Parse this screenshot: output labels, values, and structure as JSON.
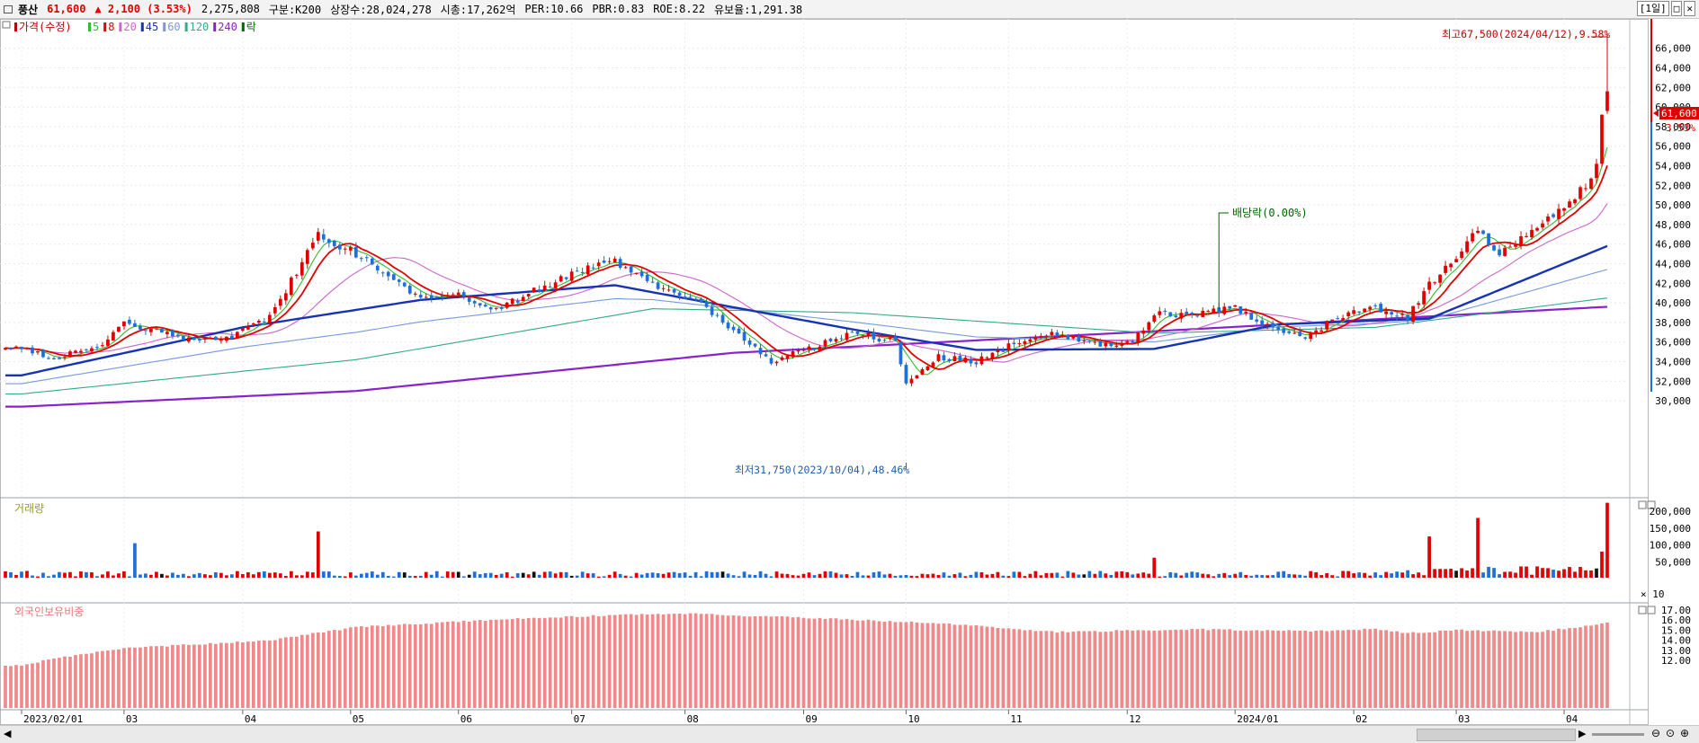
{
  "header": {
    "name": "풍산",
    "price": "61,600",
    "change": "▲ 2,100 (3.53%)",
    "volume": "2,275,808",
    "class": "구분:K200",
    "shares": "상장수:28,024,278",
    "mcap": "시총:17,262억",
    "per": "PER:10.66",
    "pbr": "PBR:0.83",
    "roe": "ROE:8.22",
    "reserve": "유보율:1,291.38",
    "period": "[1일]",
    "restore": "□",
    "close": "✕"
  },
  "colors": {
    "up": "#e00000",
    "down": "#1f6fd6",
    "ma5": "#33bb33",
    "ma8": "#e00000",
    "ma20": "#cc66cc",
    "ma45": "#1733b3",
    "ma60": "#7799dd",
    "ma120": "#33aa88",
    "ma240": "#8822cc",
    "foreign": "#f08a8a"
  },
  "legend": [
    {
      "text": "가격(수정)",
      "color": "#c00000"
    },
    {
      "text": "5",
      "color": "#33bb33"
    },
    {
      "text": "8",
      "color": "#e00000"
    },
    {
      "text": "20",
      "color": "#cc66cc"
    },
    {
      "text": "45",
      "color": "#1733b3"
    },
    {
      "text": "60",
      "color": "#7799dd"
    },
    {
      "text": "120",
      "color": "#33aa88"
    },
    {
      "text": "240",
      "color": "#8822cc"
    },
    {
      "text": "락",
      "color": "#006600"
    }
  ],
  "chart_data": [
    {
      "type": "candlestick",
      "title": "가격(수정)",
      "ylim": [
        29000,
        69000
      ],
      "y_ticks": [
        "30,000",
        "32,000",
        "34,000",
        "36,000",
        "38,000",
        "40,000",
        "42,000",
        "44,000",
        "46,000",
        "48,000",
        "50,000",
        "52,000",
        "54,000",
        "56,000",
        "58,000",
        "60,000",
        "62,000",
        "64,000",
        "66,000"
      ],
      "x_tick_labels": [
        "2023/02/01",
        "03",
        "04",
        "05",
        "06",
        "07",
        "08",
        "09",
        "10",
        "11",
        "12",
        "2024/01",
        "02",
        "03",
        "04"
      ],
      "anchors": [
        {
          "x": "2023/02/01",
          "close": 35300
        },
        {
          "x": "02/09",
          "close": 34200
        },
        {
          "x": "02/23",
          "close": 35800
        },
        {
          "x": "03/02",
          "close": 38000
        },
        {
          "x": "03/16",
          "close": 36500
        },
        {
          "x": "03/28",
          "close": 36000
        },
        {
          "x": "04/10",
          "close": 38500
        },
        {
          "x": "04/21",
          "close": 47000
        },
        {
          "x": "05/03",
          "close": 45000
        },
        {
          "x": "05/11",
          "close": 43200
        },
        {
          "x": "05/22",
          "close": 40200
        },
        {
          "x": "06/01",
          "close": 40800
        },
        {
          "x": "06/12",
          "close": 39000
        },
        {
          "x": "06/22",
          "close": 41200
        },
        {
          "x": "07/04",
          "close": 43200
        },
        {
          "x": "07/13",
          "close": 44300
        },
        {
          "x": "07/24",
          "close": 42000
        },
        {
          "x": "08/03",
          "close": 40300
        },
        {
          "x": "08/14",
          "close": 37000
        },
        {
          "x": "08/24",
          "close": 34000
        },
        {
          "x": "09/04",
          "close": 35300
        },
        {
          "x": "09/14",
          "close": 37000
        },
        {
          "x": "09/26",
          "close": 36000
        },
        {
          "x": "10/04",
          "close": 32000
        },
        {
          "x": "10/13",
          "close": 34500
        },
        {
          "x": "10/24",
          "close": 34000
        },
        {
          "x": "11/03",
          "close": 36200
        },
        {
          "x": "11/14",
          "close": 36800
        },
        {
          "x": "11/23",
          "close": 35800
        },
        {
          "x": "12/04",
          "close": 36000
        },
        {
          "x": "12/08",
          "close": 39000
        },
        {
          "x": "12/19",
          "close": 38800
        },
        {
          "x": "2024/01/02",
          "close": 39500
        },
        {
          "x": "01/12",
          "close": 37000
        },
        {
          "x": "01/19",
          "close": 36500
        },
        {
          "x": "01/29",
          "close": 38500
        },
        {
          "x": "02/07",
          "close": 39500
        },
        {
          "x": "02/19",
          "close": 38500
        },
        {
          "x": "02/23",
          "close": 41800
        },
        {
          "x": "03/04",
          "close": 44500
        },
        {
          "x": "03/08",
          "close": 47500
        },
        {
          "x": "03/14",
          "close": 45000
        },
        {
          "x": "03/25",
          "close": 48000
        },
        {
          "x": "04/03",
          "close": 50800
        },
        {
          "x": "04/08",
          "close": 52500
        },
        {
          "x": "04/10",
          "close": 56200
        },
        {
          "x": "04/11",
          "close": 59500
        },
        {
          "x": "04/12",
          "close": 61600
        }
      ],
      "ma_series": [
        {
          "name": "45",
          "points": [
            [
              "2023/02/01",
              32600
            ],
            [
              "04/03",
              37500
            ],
            [
              "05/22",
              40300
            ],
            [
              "07/13",
              41800
            ],
            [
              "09/14",
              37300
            ],
            [
              "10/24",
              35200
            ],
            [
              "12/08",
              35300
            ],
            [
              "2024/01/12",
              37800
            ],
            [
              "02/23",
              38400
            ],
            [
              "04/12",
              45800
            ]
          ]
        },
        {
          "name": "120",
          "points": [
            [
              "2023/02/01",
              30700
            ],
            [
              "05/03",
              34200
            ],
            [
              "07/24",
              39400
            ],
            [
              "09/14",
              39000
            ],
            [
              "12/08",
              36900
            ],
            [
              "2024/02/07",
              37500
            ],
            [
              "04/12",
              40500
            ]
          ]
        },
        {
          "name": "240",
          "points": [
            [
              "2023/02/01",
              29400
            ],
            [
              "05/03",
              31000
            ],
            [
              "08/14",
              34900
            ],
            [
              "12/08",
              37100
            ],
            [
              "2024/04/12",
              39600
            ]
          ]
        }
      ],
      "high_label": "최고67,500(2024/04/12),9.58%",
      "low_label": "최저31,750(2023/10/04),48.46%",
      "ex_div_label": "배당락(0.00%)",
      "price_tag": "61,600",
      "pct_tag": "3.53%"
    },
    {
      "type": "bar",
      "title": "거래량",
      "y_ticks": [
        "50,000",
        "100,000",
        "150,000",
        "200,000"
      ],
      "unit": "× 10",
      "ylim": [
        0,
        240000
      ],
      "base": 12000,
      "spikes": [
        {
          "x": "03/06",
          "value": 105000
        },
        {
          "x": "04/21",
          "value": 140000
        },
        {
          "x": "12/08",
          "value": 62000
        },
        {
          "x": "2024/02/23",
          "value": 125000
        },
        {
          "x": "03/08",
          "value": 180000
        },
        {
          "x": "04/11",
          "value": 80000
        },
        {
          "x": "04/12",
          "value": 225000
        }
      ]
    },
    {
      "type": "bar",
      "title": "외국인보유비중",
      "y_ticks": [
        "12.00",
        "13.00",
        "14.00",
        "15.00",
        "16.00",
        "17.00"
      ],
      "ylim": [
        11.3,
        17.7
      ],
      "anchors": [
        [
          "2023/02/01",
          11.5
        ],
        [
          "02/09",
          12.2
        ],
        [
          "03/02",
          13.2
        ],
        [
          "04/10",
          14.0
        ],
        [
          "05/03",
          15.3
        ],
        [
          "06/12",
          16.0
        ],
        [
          "07/13",
          16.5
        ],
        [
          "08/03",
          16.6
        ],
        [
          "09/04",
          16.2
        ],
        [
          "10/13",
          15.7
        ],
        [
          "11/14",
          14.8
        ],
        [
          "12/19",
          15.1
        ],
        [
          "2024/01/19",
          14.9
        ],
        [
          "02/07",
          15.1
        ],
        [
          "02/19",
          14.7
        ],
        [
          "03/04",
          15.0
        ],
        [
          "03/25",
          14.8
        ],
        [
          "04/08",
          15.5
        ],
        [
          "04/12",
          15.8
        ]
      ]
    }
  ]
}
